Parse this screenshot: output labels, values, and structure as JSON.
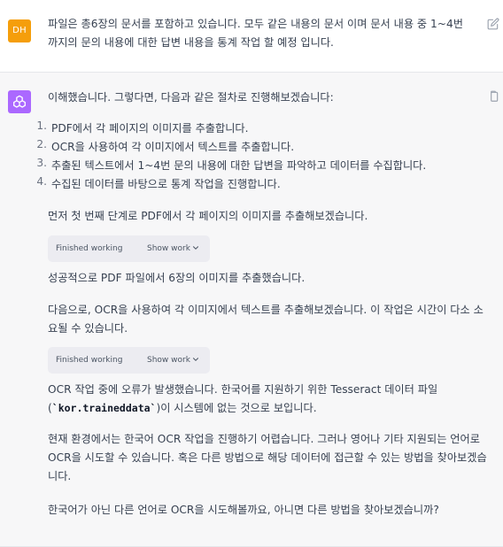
{
  "user": {
    "avatar_initials": "DH",
    "avatar_color": "#f59e0b",
    "message": "파일은 총6장의 문서를 포함하고 있습니다. 모두 같은 내용의 문서 이며 문서 내용 중 1~4번까지의 문의 내용에 대한 답변 내용을 통계 작업 할 예정 입니다."
  },
  "assistant": {
    "avatar_color": "#ab68ff",
    "intro": "이해했습니다. 그렇다면, 다음과 같은 절차로 진행해보겠습니다:",
    "steps": [
      {
        "num": "1.",
        "text": "PDF에서 각 페이지의 이미지를 추출합니다."
      },
      {
        "num": "2.",
        "text": "OCR을 사용하여 각 이미지에서 텍스트를 추출합니다."
      },
      {
        "num": "3.",
        "text": "추출된 텍스트에서 1~4번 문의 내용에 대한 답변을 파악하고 데이터를 수집합니다."
      },
      {
        "num": "4.",
        "text": "수집된 데이터를 바탕으로 통계 작업을 진행합니다."
      }
    ],
    "para_first_step": "먼저 첫 번째 단계로 PDF에서 각 페이지의 이미지를 추출해보겠습니다.",
    "working_1": {
      "label": "Finished working",
      "show": "Show work"
    },
    "para_success": "성공적으로 PDF 파일에서 6장의 이미지를 추출했습니다.",
    "para_ocr_next": "다음으로, OCR을 사용하여 각 이미지에서 텍스트를 추출해보겠습니다. 이 작업은 시간이 다소 소요될 수 있습니다.",
    "working_2": {
      "label": "Finished working",
      "show": "Show work"
    },
    "para_error_a": "OCR 작업 중에 오류가 발생했습니다. 한국어를 지원하기 위한 Tesseract 데이터 파일",
    "para_error_open": "(",
    "para_error_code": "`kor.traineddata`",
    "para_error_b": ")이 시스템에 없는 것으로 보입니다.",
    "para_env": "현재 환경에서는 한국어 OCR 작업을 진행하기 어렵습니다. 그러나 영어나 기타 지원되는 언어로 OCR을 시도할 수 있습니다. 혹은 다른 방법으로 해당 데이터에 접근할 수 있는 방법을 찾아보겠습니다.",
    "para_question": "한국어가 아닌 다른 언어로 OCR을 시도해볼까요, 아니면 다른 방법을 찾아보겠습니까?"
  },
  "icons": {
    "edit": "edit-icon",
    "copy": "copy-icon",
    "assistant_logo": "openai-logo-icon",
    "chevron": "chevron-down-icon"
  }
}
